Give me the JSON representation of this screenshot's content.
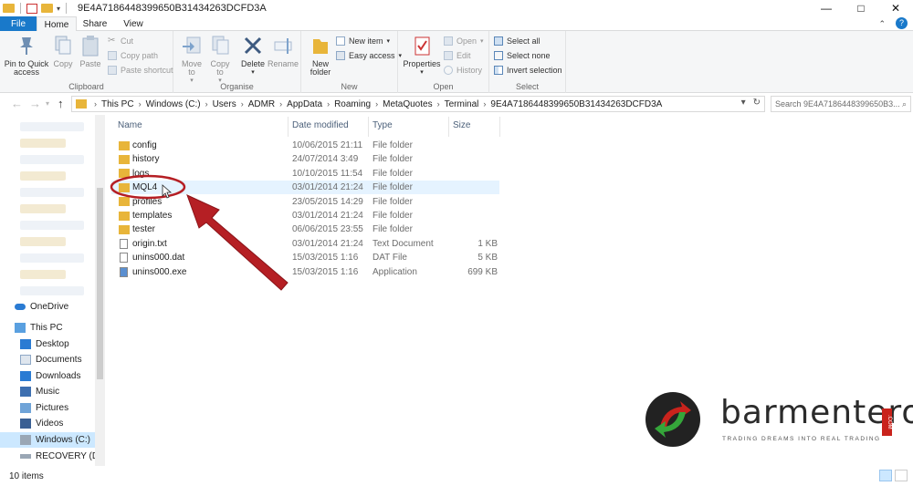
{
  "window": {
    "title": "9E4A7186448399650B31434263DCFD3A",
    "min": "—",
    "max": "□",
    "close": "✕"
  },
  "tabs": {
    "file": "File",
    "home": "Home",
    "share": "Share",
    "view": "View"
  },
  "ribbon": {
    "clipboard": {
      "title": "Clipboard",
      "pin": "Pin to Quick access",
      "copy": "Copy",
      "paste": "Paste",
      "cut": "Cut",
      "copy_path": "Copy path",
      "paste_shortcut": "Paste shortcut"
    },
    "organise": {
      "title": "Organise",
      "move_to": "Move to",
      "copy_to": "Copy to",
      "delete": "Delete",
      "rename": "Rename"
    },
    "new": {
      "title": "New",
      "new_folder": "New folder",
      "new_item": "New item",
      "easy_access": "Easy access"
    },
    "open": {
      "title": "Open",
      "properties": "Properties",
      "open": "Open",
      "edit": "Edit",
      "history": "History"
    },
    "select": {
      "title": "Select",
      "select_all": "Select all",
      "select_none": "Select none",
      "invert": "Invert selection"
    }
  },
  "address": {
    "crumbs": [
      "This PC",
      "Windows (C:)",
      "Users",
      "ADMR",
      "AppData",
      "Roaming",
      "MetaQuotes",
      "Terminal",
      "9E4A7186448399650B31434263DCFD3A"
    ],
    "search_placeholder": "Search 9E4A7186448399650B3..."
  },
  "nav": {
    "onedrive": "OneDrive",
    "this_pc": "This PC",
    "items": [
      "Desktop",
      "Documents",
      "Downloads",
      "Music",
      "Pictures",
      "Videos",
      "Windows (C:)",
      "RECOVERY (D:)"
    ]
  },
  "list": {
    "headers": {
      "name": "Name",
      "date": "Date modified",
      "type": "Type",
      "size": "Size"
    },
    "rows": [
      {
        "name": "config",
        "date": "10/06/2015 21:11",
        "type": "File folder",
        "size": "",
        "kind": "folder"
      },
      {
        "name": "history",
        "date": "24/07/2014 3:49",
        "type": "File folder",
        "size": "",
        "kind": "folder"
      },
      {
        "name": "logs",
        "date": "10/10/2015 11:54",
        "type": "File folder",
        "size": "",
        "kind": "folder"
      },
      {
        "name": "MQL4",
        "date": "03/01/2014 21:24",
        "type": "File folder",
        "size": "",
        "kind": "folder"
      },
      {
        "name": "profiles",
        "date": "23/05/2015 14:29",
        "type": "File folder",
        "size": "",
        "kind": "folder"
      },
      {
        "name": "templates",
        "date": "03/01/2014 21:24",
        "type": "File folder",
        "size": "",
        "kind": "folder"
      },
      {
        "name": "tester",
        "date": "06/06/2015 23:55",
        "type": "File folder",
        "size": "",
        "kind": "folder"
      },
      {
        "name": "origin.txt",
        "date": "03/01/2014 21:24",
        "type": "Text Document",
        "size": "1 KB",
        "kind": "txt"
      },
      {
        "name": "unins000.dat",
        "date": "15/03/2015 1:16",
        "type": "DAT File",
        "size": "5 KB",
        "kind": "dat"
      },
      {
        "name": "unins000.exe",
        "date": "15/03/2015 1:16",
        "type": "Application",
        "size": "699 KB",
        "kind": "exe"
      }
    ]
  },
  "status": {
    "count": "10 items"
  },
  "logo": {
    "name": "barmenteros",
    "tagline": "TRADING DREAMS INTO REAL TRADING",
    "com": ".COM"
  },
  "colors": {
    "accent": "#1979ca",
    "folder": "#e8b53a",
    "arrow": "#b51f24",
    "hover_row": "#e5f3ff",
    "selected_nav": "#cce8ff"
  }
}
